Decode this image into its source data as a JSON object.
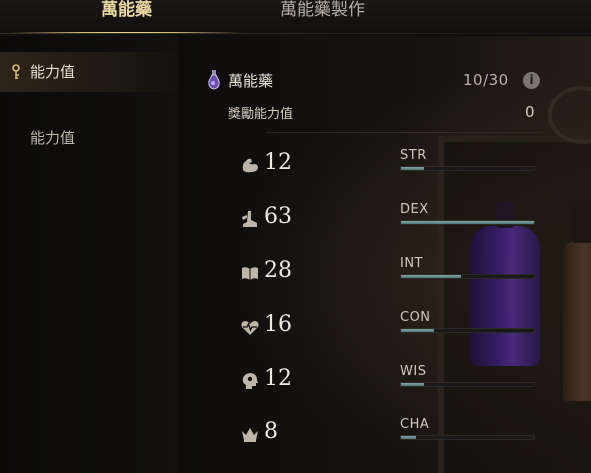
{
  "tabs": [
    {
      "label": "萬能藥",
      "active": true
    },
    {
      "label": "萬能藥製作",
      "active": false
    }
  ],
  "sidebar": {
    "items": [
      {
        "label": "能力值",
        "active": true
      },
      {
        "label": "能力值",
        "active": false
      }
    ]
  },
  "potion": {
    "title": "萬能藥",
    "count": "10/30",
    "info": "i",
    "bonus_label": "獎勵能力值",
    "bonus_value": "0"
  },
  "stats": [
    {
      "value": "12",
      "name": "STR",
      "icon": "muscle-arm-icon",
      "fill": 0.17
    },
    {
      "value": "63",
      "name": "DEX",
      "icon": "winged-boot-icon",
      "fill": 1.0
    },
    {
      "value": "28",
      "name": "INT",
      "icon": "open-book-icon",
      "fill": 0.45
    },
    {
      "value": "16",
      "name": "CON",
      "icon": "heart-pulse-icon",
      "fill": 0.25
    },
    {
      "value": "12",
      "name": "WIS",
      "icon": "head-mind-icon",
      "fill": 0.17
    },
    {
      "value": "8",
      "name": "CHA",
      "icon": "crown-icon",
      "fill": 0.11
    }
  ],
  "colors": {
    "accent_gold": "#e8d7a4",
    "bar_fill": "#7fa7aa",
    "potion_purple": "#512c8d"
  }
}
